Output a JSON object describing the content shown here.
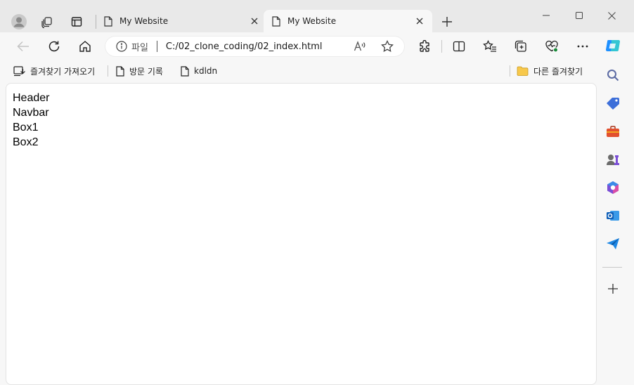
{
  "window": {
    "tabs": [
      {
        "title": "My Website",
        "active": false
      },
      {
        "title": "My Website",
        "active": true
      }
    ]
  },
  "address": {
    "site_label": "파일",
    "url": "C:/02_clone_coding/02_index.html"
  },
  "bookmarks": {
    "import_label": "즐겨찾기 가져오기",
    "items": [
      {
        "label": "방문 기록",
        "icon": "page-icon"
      },
      {
        "label": "kdldn",
        "icon": "page-icon"
      }
    ],
    "other_label": "다른 즐겨찾기"
  },
  "page": {
    "lines": [
      "Header",
      "Navbar",
      "Box1",
      "Box2"
    ]
  },
  "sidebar": {
    "items": [
      "copilot-icon",
      "search-icon",
      "shopping-tag-icon",
      "tools-icon",
      "games-icon",
      "microsoft365-icon",
      "outlook-icon",
      "send-icon",
      "add-icon"
    ]
  },
  "colors": {
    "accent": "#0f6cbd",
    "tabstrip": "#e9e9e9",
    "toolbar": "#f7f7f7",
    "content": "#ffffff"
  }
}
